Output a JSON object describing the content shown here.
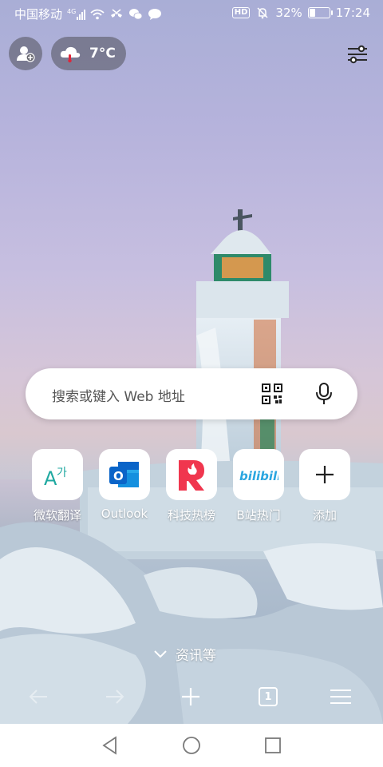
{
  "status_bar": {
    "carrier": "中国移动",
    "network_badge": "4G",
    "battery_percent": "32%",
    "battery_level": 0.32,
    "time": "17:24",
    "hd_badge": "HD",
    "icons": [
      "signal-icon",
      "wifi-icon",
      "missed-call-icon",
      "wechat-icon",
      "message-icon",
      "mute-icon",
      "battery-icon"
    ]
  },
  "header": {
    "avatar_icon": "add-user-icon",
    "weather": {
      "temperature": "7°C",
      "icon": "cloud-thermometer-icon"
    },
    "settings_icon": "sliders-icon"
  },
  "search": {
    "placeholder": "搜索或键入 Web 地址",
    "qr_icon": "qr-code-icon",
    "mic_icon": "microphone-icon"
  },
  "shortcuts": [
    {
      "label": "微软翻译",
      "icon": "translator-icon"
    },
    {
      "label": "Outlook",
      "icon": "outlook-icon"
    },
    {
      "label": "科技热榜",
      "icon": "tech-hot-icon"
    },
    {
      "label": "B站热门",
      "icon": "bilibili-icon"
    },
    {
      "label": "添加",
      "icon": "plus-icon"
    }
  ],
  "news": {
    "label": "资讯等",
    "icon": "chevron-down-icon"
  },
  "toolbar": {
    "tab_count": "1",
    "icons": [
      "back-arrow-icon",
      "forward-arrow-icon",
      "new-tab-plus-icon",
      "tabs-icon",
      "menu-icon"
    ]
  },
  "colors": {
    "outlook_blue": "#0a64c8",
    "tech_red": "#f0364e",
    "bilibili_blue": "#2aa6e0",
    "translator_teal": "#20a9a1"
  }
}
